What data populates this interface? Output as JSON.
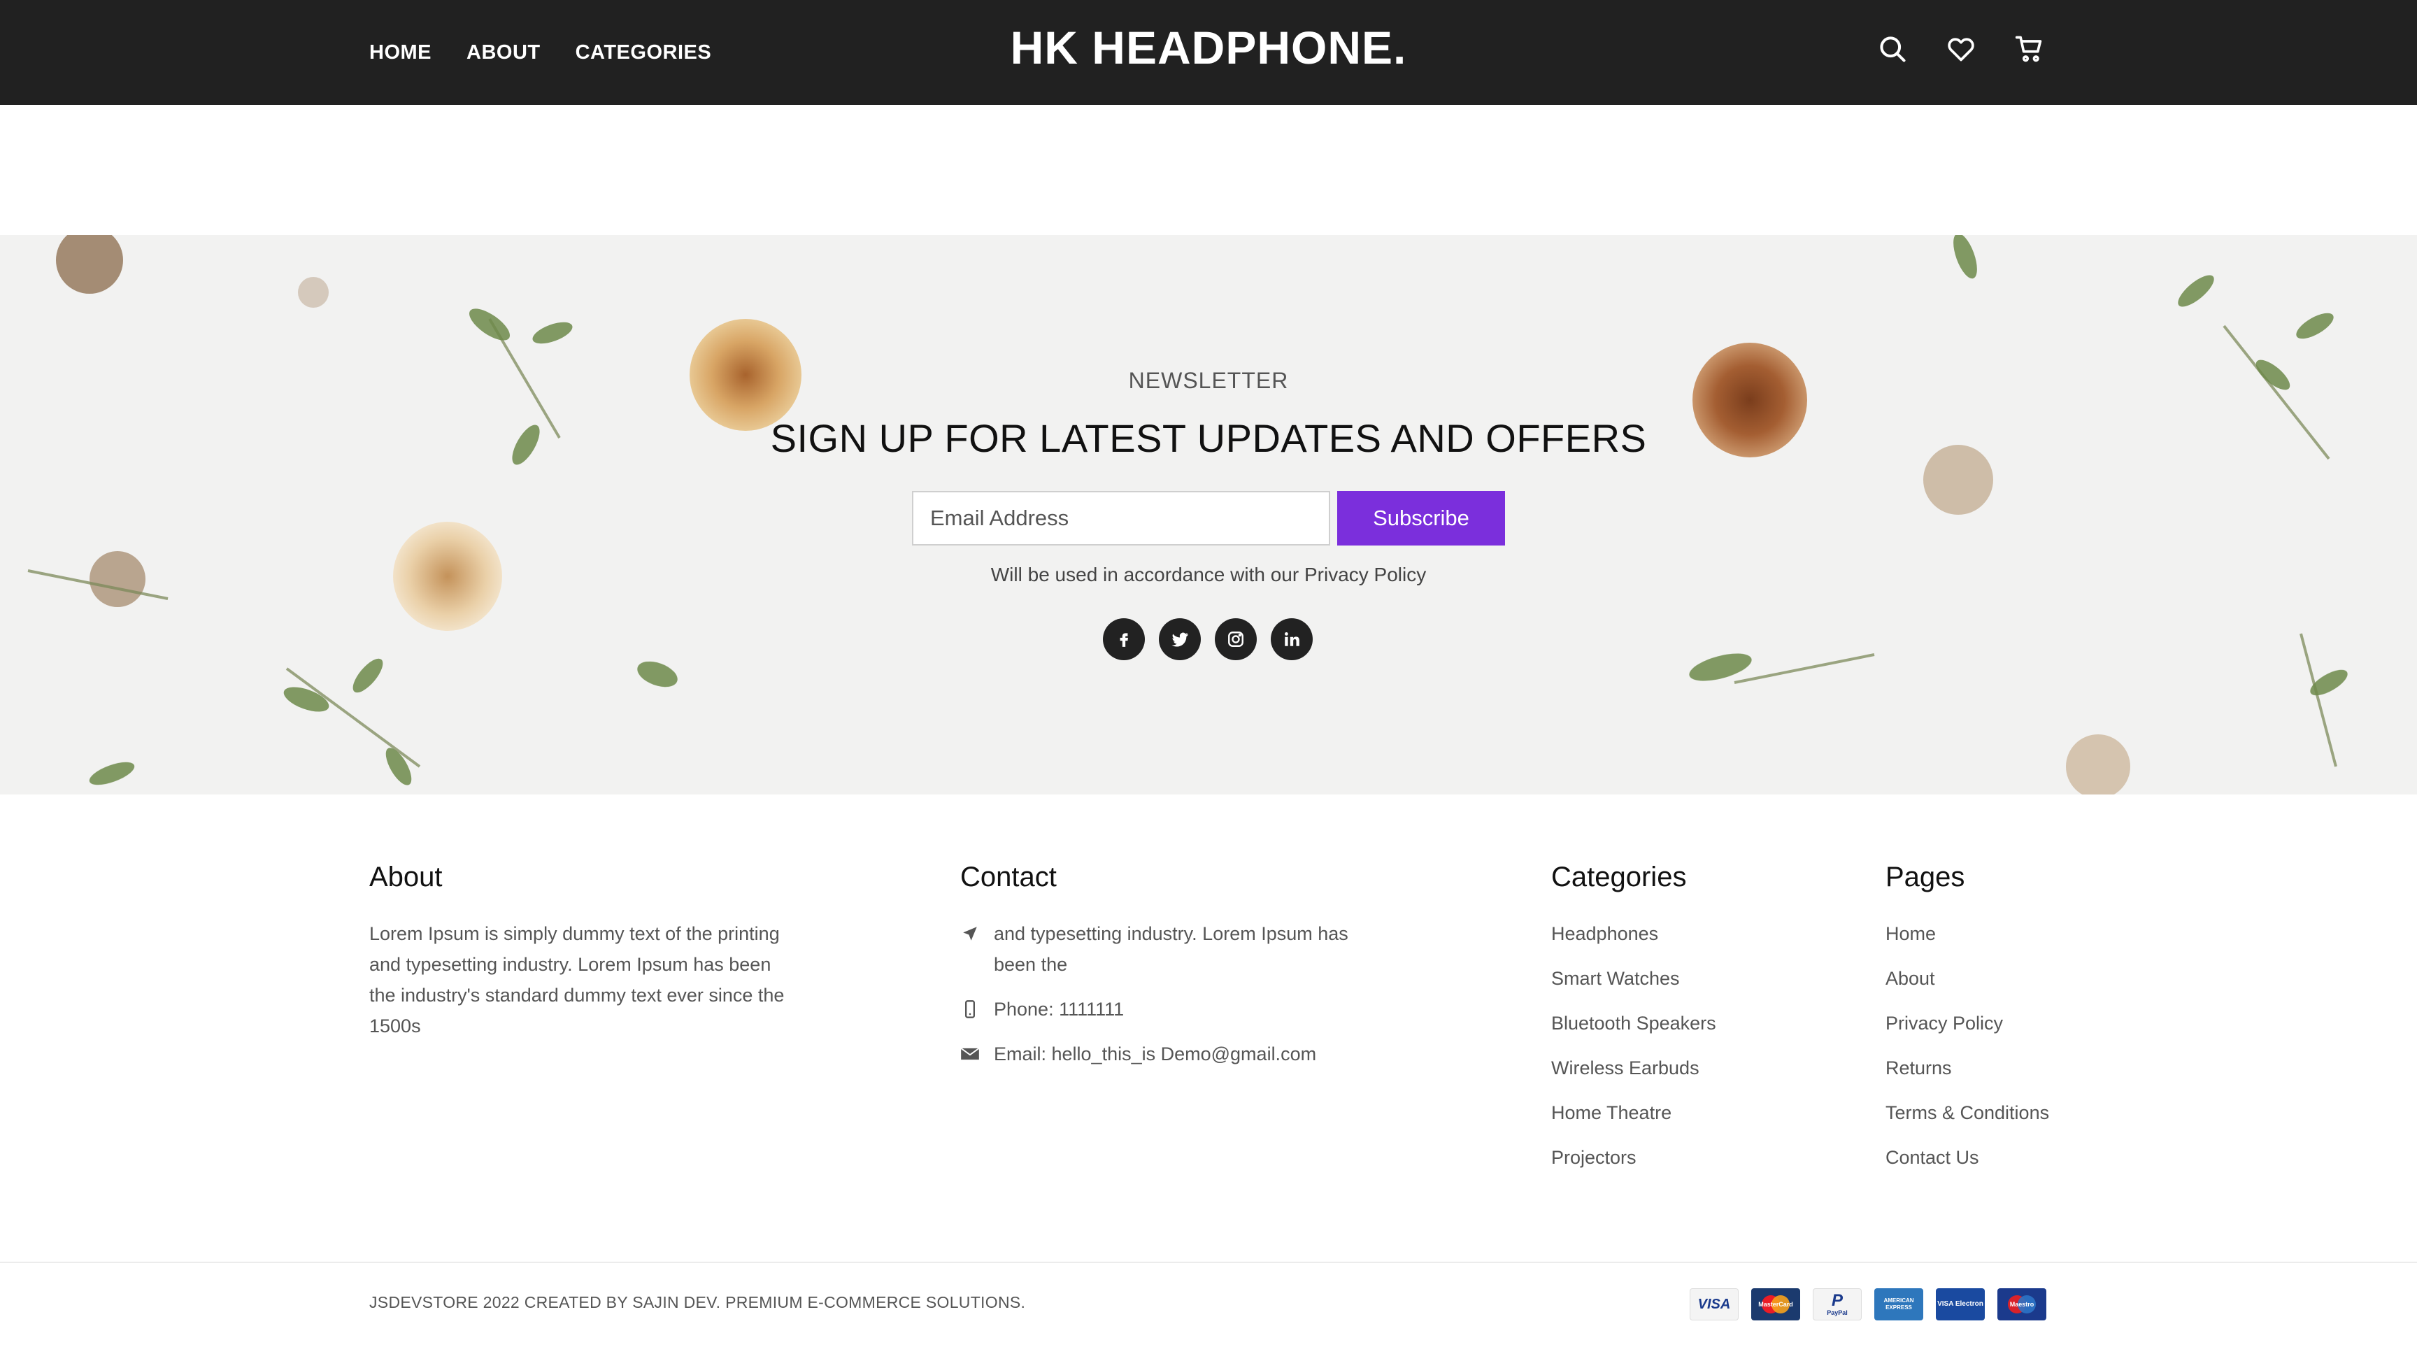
{
  "header": {
    "nav": [
      "HOME",
      "ABOUT",
      "CATEGORIES"
    ],
    "logo": "HK HEADPHONE.",
    "icons": [
      "search-icon",
      "heart-icon",
      "cart-icon"
    ]
  },
  "newsletter": {
    "label": "NEWSLETTER",
    "title": "SIGN UP FOR LATEST UPDATES AND OFFERS",
    "placeholder": "Email Address",
    "button": "Subscribe",
    "note": "Will be used in accordance with our Privacy Policy",
    "socials": [
      "facebook-icon",
      "twitter-icon",
      "instagram-icon",
      "linkedin-icon"
    ],
    "accent_color": "#7b2fdc"
  },
  "footer": {
    "about": {
      "title": "About",
      "text": "Lorem Ipsum is simply dummy text of the printing and typesetting industry. Lorem Ipsum has been the industry's standard dummy text ever since the 1500s"
    },
    "contact": {
      "title": "Contact",
      "address": "and typesetting industry. Lorem Ipsum has been the",
      "phone": "Phone: 1111111",
      "email": "Email: hello_this_is Demo@gmail.com"
    },
    "categories": {
      "title": "Categories",
      "items": [
        "Headphones",
        "Smart Watches",
        "Bluetooth Speakers",
        "Wireless Earbuds",
        "Home Theatre",
        "Projectors"
      ]
    },
    "pages": {
      "title": "Pages",
      "items": [
        "Home",
        "About",
        "Privacy Policy",
        "Returns",
        "Terms & Conditions",
        "Contact Us"
      ]
    },
    "copyright": "JSDEVSTORE 2022 CREATED BY SAJIN DEV. PREMIUM E-COMMERCE SOLUTIONS.",
    "payments": [
      "VISA",
      "MasterCard",
      "PayPal",
      "AMERICAN EXPRESS",
      "VISA Electron",
      "Maestro"
    ]
  }
}
